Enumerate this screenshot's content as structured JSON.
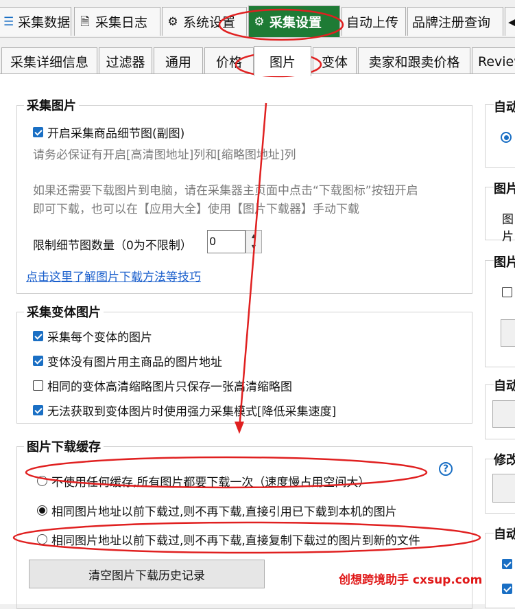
{
  "top_tabs": [
    {
      "label": "采集数据",
      "icon": "data-icon"
    },
    {
      "label": "采集日志",
      "icon": "log-icon"
    },
    {
      "label": "系统设置",
      "icon": "gear-icon"
    },
    {
      "label": "采集设置",
      "icon": "gear-icon"
    },
    {
      "label": "自动上传",
      "icon": ""
    },
    {
      "label": "品牌注册查询",
      "icon": ""
    }
  ],
  "sub_tabs": [
    "采集详细信息",
    "过滤器",
    "通用",
    "价格",
    "图片",
    "变体",
    "卖家和跟卖价格",
    "Review"
  ],
  "collect_images": {
    "title": "采集图片",
    "enable_label": "开启采集商品细节图(副图)",
    "hint1": "请务必保证有开启[高清图地址]列和[缩略图地址]列",
    "hint2a": "如果还需要下载图片到电脑，请在采集器主页面中点击“下载图标”按钮开启",
    "hint2b": "即可下载，也可以在【应用大全】使用【图片下载器】手动下载",
    "limit_label": "限制细节图数量（0为不限制）",
    "limit_value": "0",
    "link": "点击这里了解图片下载方法等技巧"
  },
  "variant_images": {
    "title": "采集变体图片",
    "items": [
      {
        "label": "采集每个变体的图片",
        "checked": true
      },
      {
        "label": "变体没有图片用主商品的图片地址",
        "checked": true
      },
      {
        "label": "相同的变体高清缩略图片只保存一张高清缩略图",
        "checked": false
      },
      {
        "label": "无法获取到变体图片时使用强力采集模式[降低采集速度]",
        "checked": true
      }
    ]
  },
  "download_cache": {
    "title": "图片下载缓存",
    "options": [
      {
        "label": "不使用任何缓存,所有图片都要下载一次（速度慢占用空间大）",
        "selected": false
      },
      {
        "label": "相同图片地址以前下载过,则不再下载,直接引用已下载到本机的图片",
        "selected": true
      },
      {
        "label": "相同图片地址以前下载过,则不再下载,直接复制下载过的图片到新的文件",
        "selected": false
      }
    ],
    "help": "?",
    "clear_button": "清空图片下载历史记录"
  },
  "right_column_titles": [
    "自动",
    "图片",
    "图片",
    "自动",
    "修改",
    "自动"
  ],
  "right_column_texts": [
    "图片"
  ],
  "watermark": "创想跨境助手 cxsup.com",
  "annotation_color": "#e02020",
  "accent_color": "#1e7b35"
}
